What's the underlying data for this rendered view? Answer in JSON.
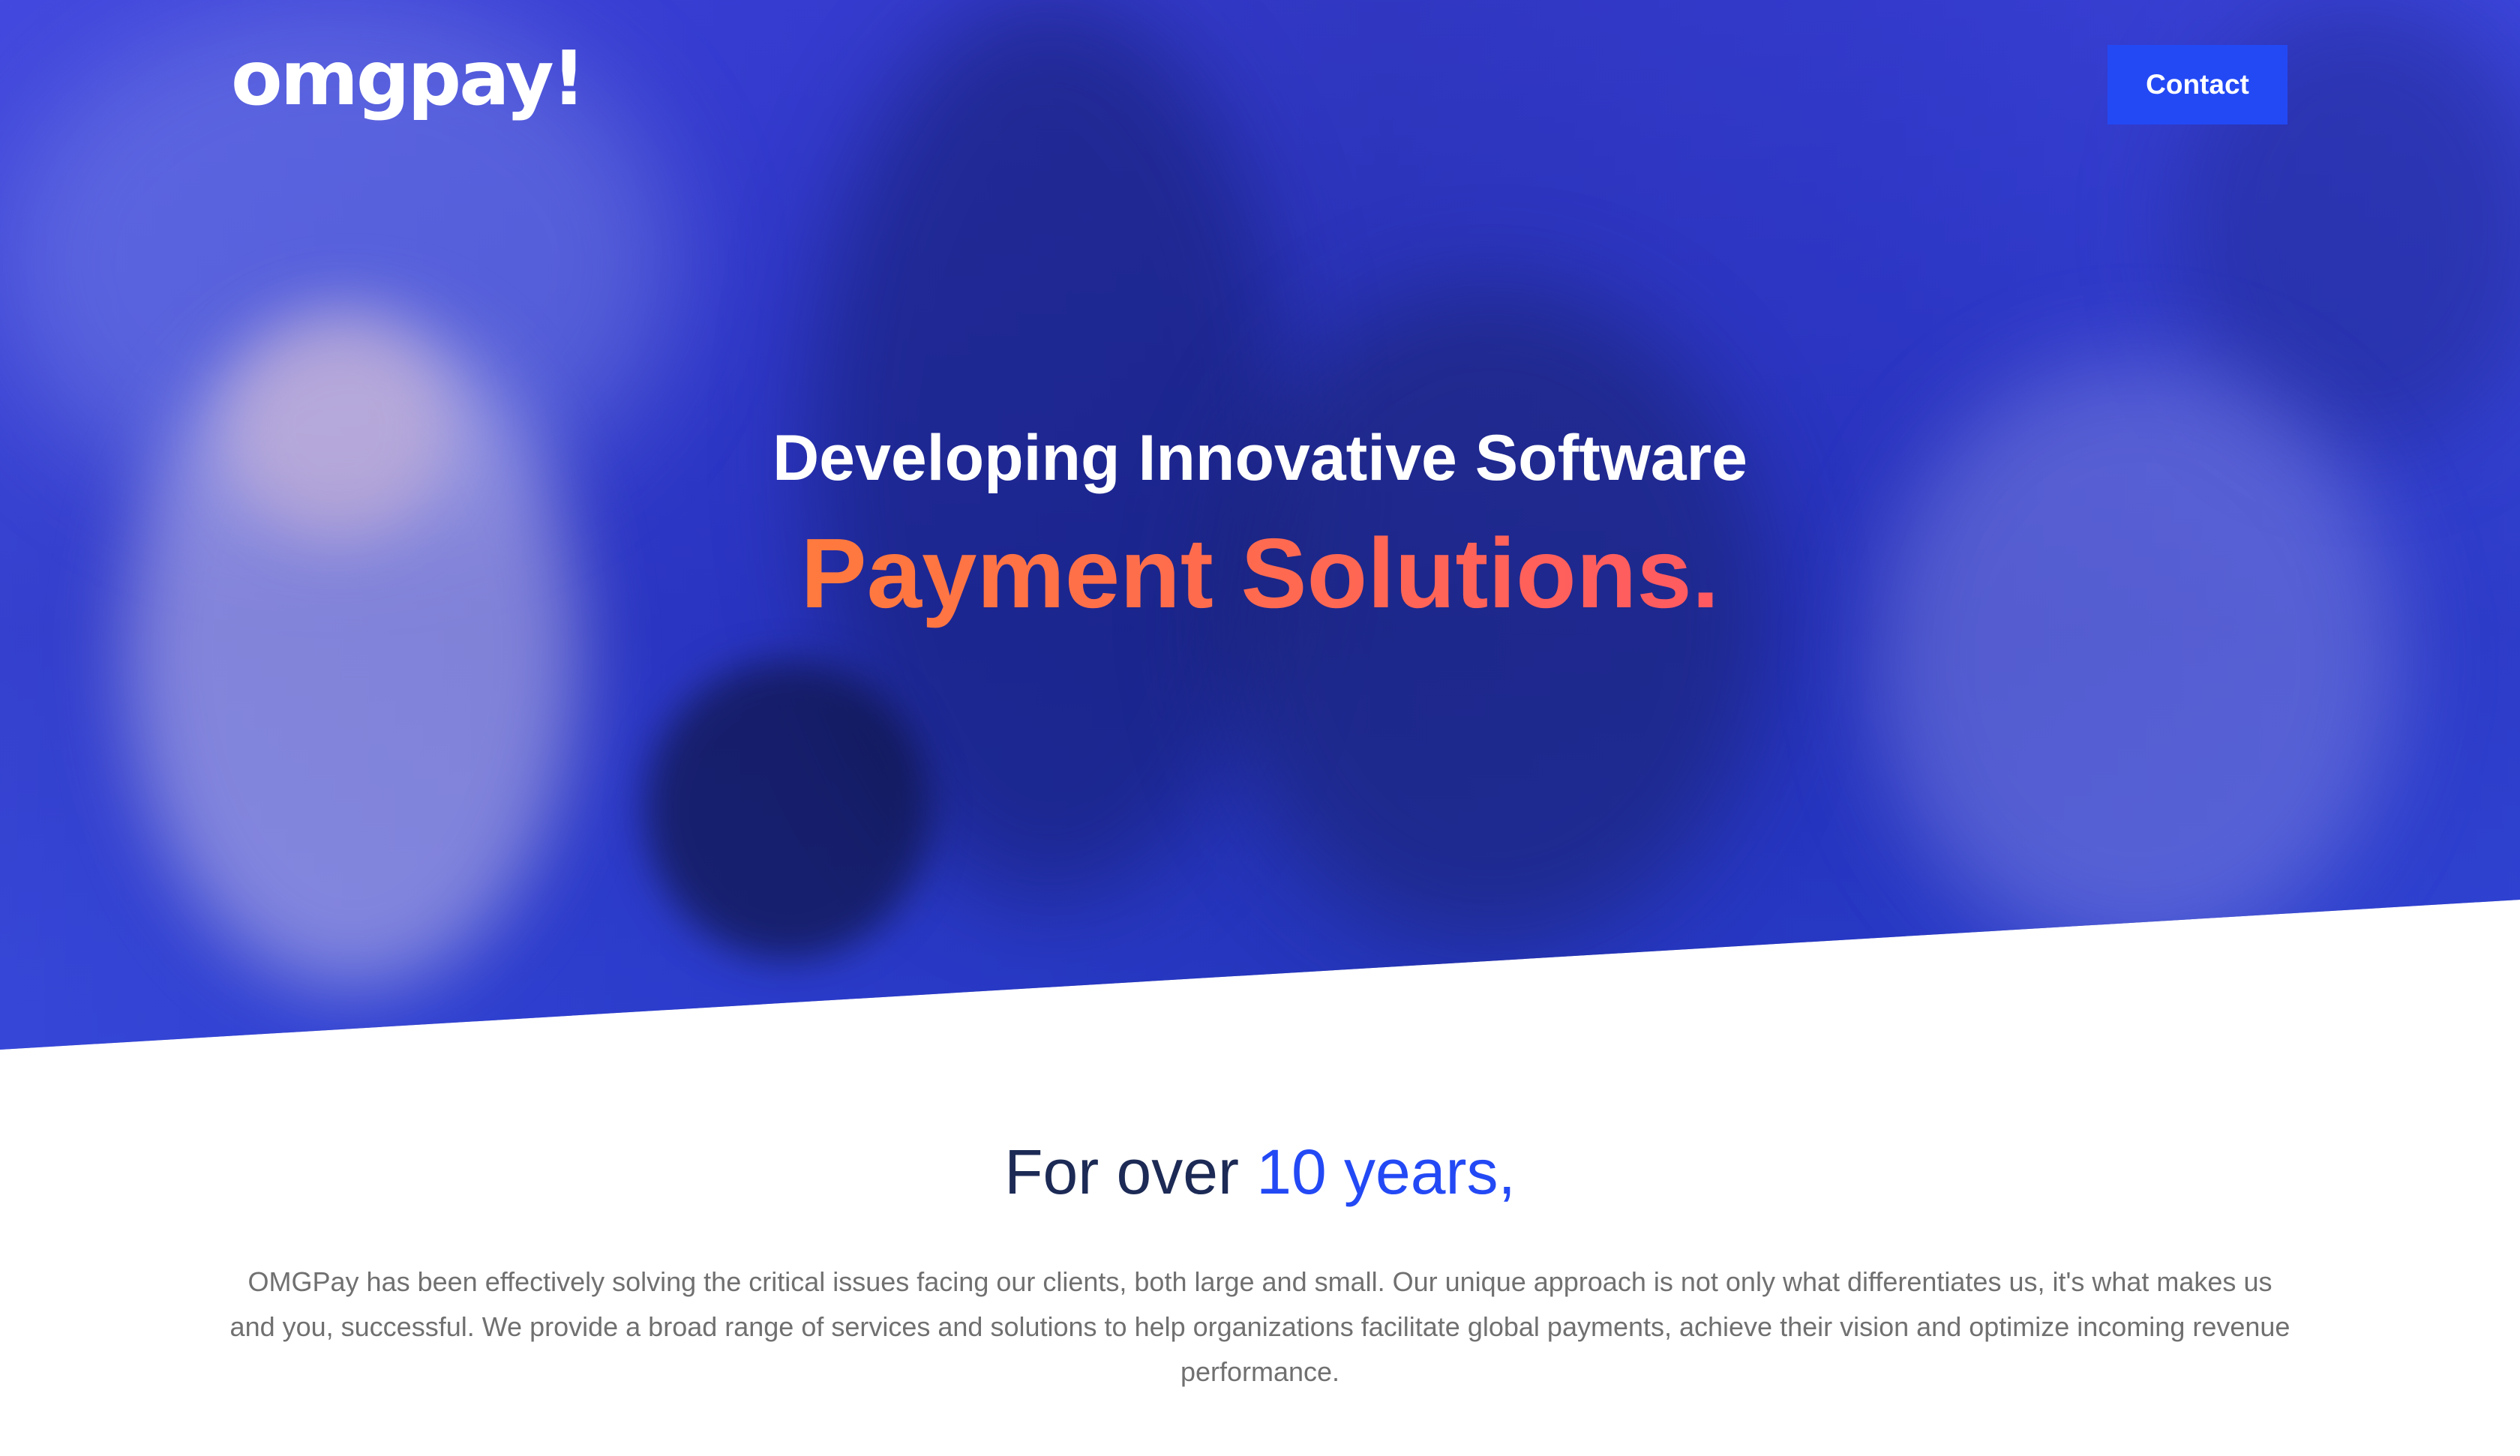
{
  "header": {
    "logo_text": "omgpay!",
    "contact_label": "Contact"
  },
  "hero": {
    "title": "Developing Innovative Software",
    "subtitle": "Payment Solutions.",
    "colors": {
      "overlay": "#2a3bd0",
      "subtitle_from": "#ff7a3d",
      "subtitle_to": "#ff5a62",
      "button": "#2349f5"
    }
  },
  "about": {
    "heading_prefix": "For over",
    "heading_accent": "10 years,",
    "body": "OMGPay has been effectively solving the critical issues facing our clients, both large and small. Our unique approach is not only what differentiates us, it's what makes us and you, successful. We provide a broad range of services and solutions to help organizations facilitate global payments, achieve their vision and optimize incoming revenue performance.",
    "colors": {
      "heading": "#1c2a55",
      "accent": "#2349f5",
      "body": "#707070"
    }
  }
}
